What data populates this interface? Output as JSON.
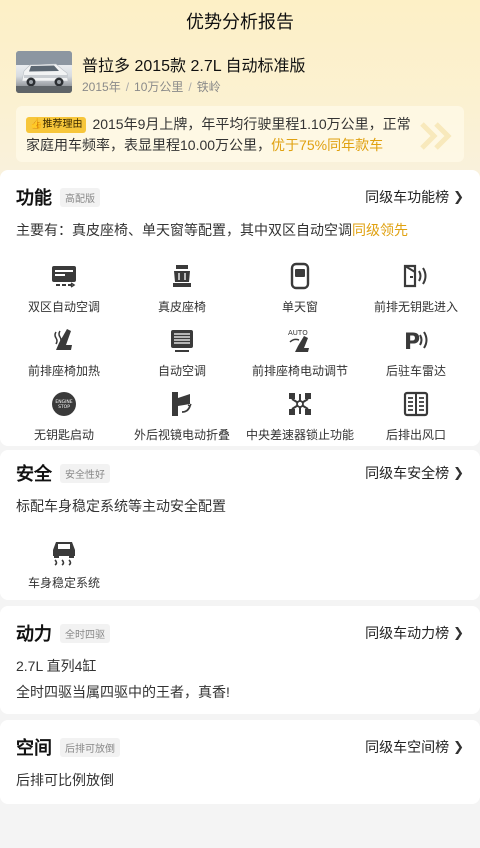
{
  "header": {
    "title": "优势分析报告"
  },
  "car": {
    "name": "普拉多 2015款 2.7L 自动标准版",
    "meta": [
      "2015年",
      "10万公里",
      "铁岭"
    ],
    "thumb_icon": "suv-photo"
  },
  "reason": {
    "tag": "推荐理由",
    "text": "2015年9月上牌，年平均行驶里程1.10万公里，正常家庭用车频率，表显里程10.00万公里，",
    "highlight": "优于75%同年款车"
  },
  "sections": {
    "function": {
      "title": "功能",
      "badge": "高配版",
      "rank_link": "同级车功能榜",
      "text_prefix": "主要有：真皮座椅、单天窗等配置，其中双区自动空调",
      "text_highlight": "同级领先",
      "features": [
        {
          "label": "双区自动空调",
          "icon": "climate-control-icon"
        },
        {
          "label": "真皮座椅",
          "icon": "leather-seat-icon"
        },
        {
          "label": "单天窗",
          "icon": "sunroof-icon"
        },
        {
          "label": "前排无钥匙进入",
          "icon": "keyless-entry-icon"
        },
        {
          "label": "前排座椅加热",
          "icon": "seat-heating-icon"
        },
        {
          "label": "自动空调",
          "icon": "auto-ac-icon"
        },
        {
          "label": "前排座椅电动调节",
          "icon": "power-seat-icon"
        },
        {
          "label": "后驻车雷达",
          "icon": "parking-radar-icon"
        },
        {
          "label": "无钥匙启动",
          "icon": "push-start-icon"
        },
        {
          "label": "外后视镜电动折叠",
          "icon": "mirror-fold-icon"
        },
        {
          "label": "中央差速器锁止功能",
          "icon": "diff-lock-icon"
        },
        {
          "label": "后排出风口",
          "icon": "rear-vent-icon"
        }
      ]
    },
    "safety": {
      "title": "安全",
      "badge": "安全性好",
      "rank_link": "同级车安全榜",
      "text": "标配车身稳定系统等主动安全配置",
      "features": [
        {
          "label": "车身稳定系统",
          "icon": "stability-control-icon"
        }
      ]
    },
    "power": {
      "title": "动力",
      "badge": "全时四驱",
      "rank_link": "同级车动力榜",
      "line1": "2.7L 直列4缸",
      "line2": "全时四驱当属四驱中的王者，真香!"
    },
    "space": {
      "title": "空间",
      "badge": "后排可放倒",
      "rank_link": "同级车空间榜",
      "text": "后排可比例放倒"
    }
  },
  "colors": {
    "accent": "#e0a110",
    "tag_bg": "#f7c63a",
    "hero_bg": "#fdf0c6"
  }
}
